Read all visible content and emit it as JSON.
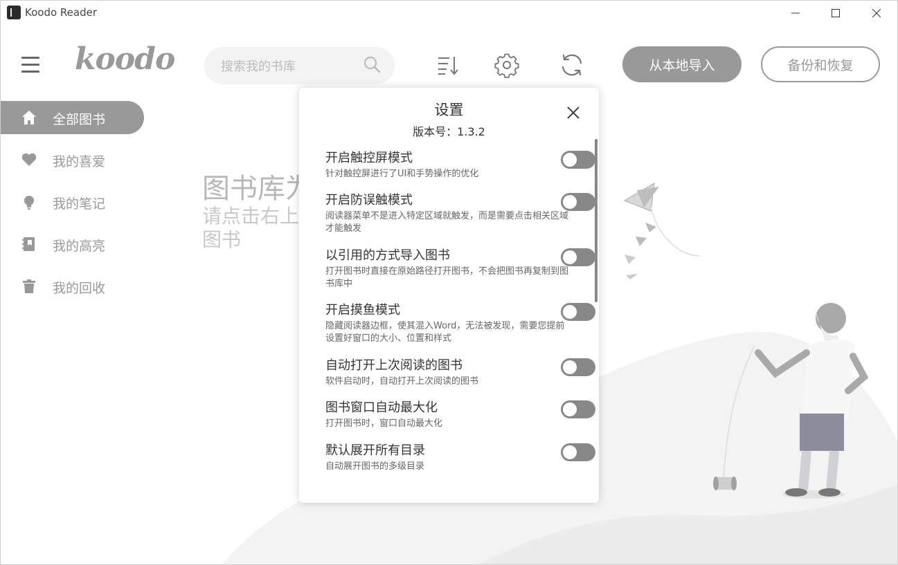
{
  "window": {
    "title": "Koodo Reader"
  },
  "header": {
    "logo": "koodo",
    "search_placeholder": "搜索我的书库",
    "import_button": "从本地导入",
    "backup_button": "备份和恢复"
  },
  "sidebar": {
    "items": [
      {
        "label": "全部图书",
        "icon": "home-icon"
      },
      {
        "label": "我的喜爱",
        "icon": "heart-icon"
      },
      {
        "label": "我的笔记",
        "icon": "bulb-icon"
      },
      {
        "label": "我的高亮",
        "icon": "notebook-icon"
      },
      {
        "label": "我的回收",
        "icon": "trash-icon"
      }
    ]
  },
  "empty_state": {
    "title": "图书库为",
    "subtitle": "请点击右上图书"
  },
  "dialog": {
    "title": "设置",
    "version": "版本号：1.3.2",
    "settings": [
      {
        "title": "开启触控屏模式",
        "desc": "针对触控屏进行了UI和手势操作的优化",
        "enabled": false
      },
      {
        "title": "开启防误触模式",
        "desc": "阅读器菜单不是进入特定区域就触发，而是需要点击相关区域才能触发",
        "enabled": false
      },
      {
        "title": "以引用的方式导入图书",
        "desc": "打开图书时直接在原始路径打开图书，不会把图书再复制到图书库中",
        "enabled": false
      },
      {
        "title": "开启摸鱼模式",
        "desc": "隐藏阅读器边框，使其混入Word，无法被发现，需要您提前设置好窗口的大小、位置和样式",
        "enabled": false
      },
      {
        "title": "自动打开上次阅读的图书",
        "desc": "软件启动时，自动打开上次阅读的图书",
        "enabled": false
      },
      {
        "title": "图书窗口自动最大化",
        "desc": "打开图书时，窗口自动最大化",
        "enabled": false
      },
      {
        "title": "默认展开所有目录",
        "desc": "自动展开图书的多级目录",
        "enabled": false
      }
    ]
  }
}
